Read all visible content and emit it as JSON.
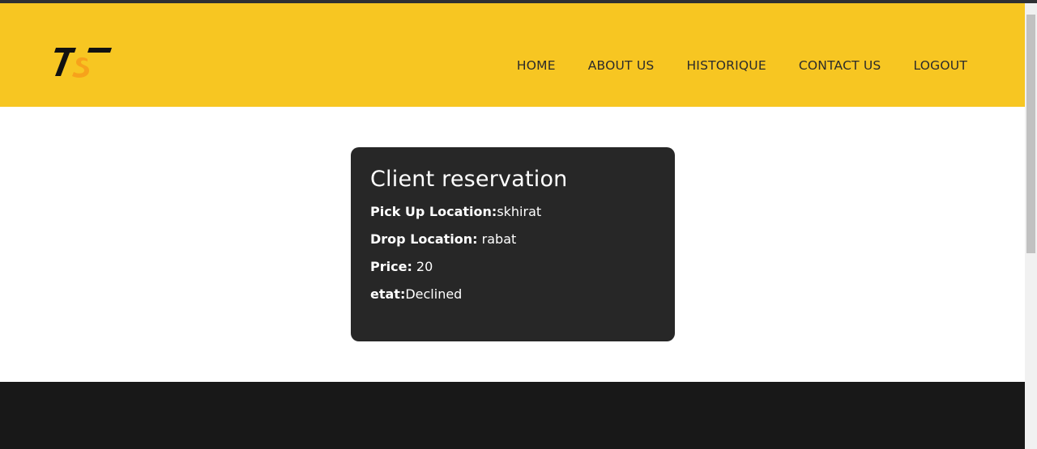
{
  "brand": {
    "logo_alt": "TS"
  },
  "nav": {
    "items": [
      {
        "label": "HOME"
      },
      {
        "label": "ABOUT US"
      },
      {
        "label": "HISTORIQUE"
      },
      {
        "label": "CONTACT US"
      },
      {
        "label": "LOGOUT"
      }
    ]
  },
  "card": {
    "title": "Client reservation",
    "fields": [
      {
        "label": "Pick Up Location:",
        "value": "skhirat"
      },
      {
        "label": "Drop Location:",
        "value": " rabat"
      },
      {
        "label": "Price:",
        "value": " 20"
      },
      {
        "label": "etat:",
        "value": "Declined"
      }
    ]
  },
  "colors": {
    "header_bg": "#f7c622",
    "card_bg": "#272727",
    "footer_bg": "#181818",
    "logo_accent": "#f7a21b"
  },
  "icons": {
    "logo": "ts-logo-icon"
  }
}
